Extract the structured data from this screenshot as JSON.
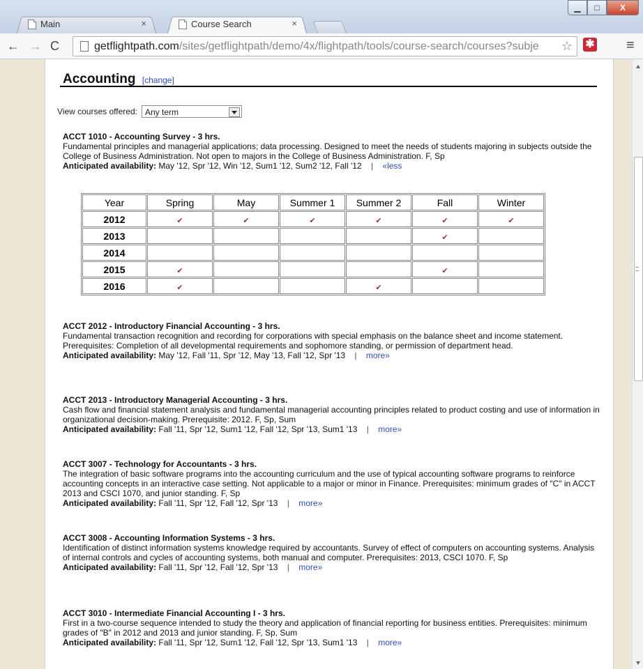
{
  "browser": {
    "tabs": [
      {
        "label": "Main"
      },
      {
        "label": "Course Search"
      }
    ],
    "url_host": "getflightpath.com",
    "url_path": "/sites/getflightpath/demo/4x/flightpath/tools/course-search/courses?subje"
  },
  "page": {
    "title": "Accounting",
    "change_link": "[change]",
    "filter_label": "View courses offered:",
    "filter_value": "Any term"
  },
  "grid": {
    "headers": [
      "Year",
      "Spring",
      "May",
      "Summer 1",
      "Summer 2",
      "Fall",
      "Winter"
    ],
    "rows": [
      {
        "year": "2012",
        "marks": [
          1,
          1,
          1,
          1,
          1,
          1
        ]
      },
      {
        "year": "2013",
        "marks": [
          0,
          0,
          0,
          0,
          1,
          0
        ]
      },
      {
        "year": "2014",
        "marks": [
          0,
          0,
          0,
          0,
          0,
          0
        ]
      },
      {
        "year": "2015",
        "marks": [
          1,
          0,
          0,
          0,
          1,
          0
        ]
      },
      {
        "year": "2016",
        "marks": [
          1,
          0,
          0,
          1,
          0,
          0
        ]
      }
    ],
    "check_glyph": "✔"
  },
  "courses": [
    {
      "code": "ACCT 1010",
      "title": "ACCT 1010 - Accounting Survey - 3 hrs.",
      "desc": "Fundamental principles and managerial applications; data processing. Designed to meet the needs of students majoring in subjects outside the College of Business Administration. Not open to majors in the College of Business Administration. F, Sp",
      "avail_label": "Anticipated availability:",
      "avail": "May '12, Spr '12, Win '12, Sum1 '12, Sum2 '12, Fall '12",
      "toggle": "«less",
      "separator": "|"
    },
    {
      "code": "ACCT 2012",
      "title": "ACCT 2012 - Introductory Financial Accounting - 3 hrs.",
      "desc": "Fundamental transaction recognition and recording for corporations with special emphasis on the balance sheet and income statement. Prerequisites: Completion of all developmental requirements and sophomore standing, or permission of department head.",
      "avail_label": "Anticipated availability:",
      "avail": "May '12, Fall '11, Spr '12, May '13, Fall '12, Spr '13",
      "toggle": "more»",
      "separator": "|"
    },
    {
      "code": "ACCT 2013",
      "title": "ACCT 2013 - Introductory Managerial Accounting - 3 hrs.",
      "desc": "Cash flow and financial statement analysis and fundamental managerial accounting principles related to product costing and use of information in organizational decision-making. Prerequisite: 2012. F, Sp, Sum",
      "avail_label": "Anticipated availability:",
      "avail": "Fall '11, Spr '12, Sum1 '12, Fall '12, Spr '13, Sum1 '13",
      "toggle": "more»",
      "separator": "|"
    },
    {
      "code": "ACCT 3007",
      "title": "ACCT 3007 - Technology for Accountants - 3 hrs.",
      "desc": "The integration of basic software programs into the accounting curriculum and the use of typical accounting software programs to reinforce accounting concepts in an interactive case setting. Not applicable to a major or minor in Finance. Prerequisites: minimum grades of \"C\" in ACCT 2013 and CSCI 1070, and junior standing. F, Sp",
      "avail_label": "Anticipated availability:",
      "avail": "Fall '11, Spr '12, Fall '12, Spr '13",
      "toggle": "more»",
      "separator": "|"
    },
    {
      "code": "ACCT 3008",
      "title": "ACCT 3008 - Accounting Information Systems - 3 hrs.",
      "desc": "Identification of distinct information systems knowledge required by accountants. Survey of effect of computers on accounting systems. Analysis of internal controls and cycles of accounting systems, both manual and computer. Prerequisites: 2013, CSCI 1070. F, Sp",
      "avail_label": "Anticipated availability:",
      "avail": "Fall '11, Spr '12, Fall '12, Spr '13",
      "toggle": "more»",
      "separator": "|"
    },
    {
      "code": "ACCT 3010",
      "title": "ACCT 3010 - Intermediate Financial Accounting I - 3 hrs.",
      "desc": "First in a two-course sequence intended to study the theory and application of financial reporting for business entities. Prerequisites: minimum grades of \"B\" in 2012 and 2013 and junior standing. F, Sp, Sum",
      "avail_label": "Anticipated availability:",
      "avail": "Fall '11, Spr '12, Sum1 '12, Fall '12, Spr '13, Sum1 '13",
      "toggle": "more»",
      "separator": "|"
    }
  ]
}
